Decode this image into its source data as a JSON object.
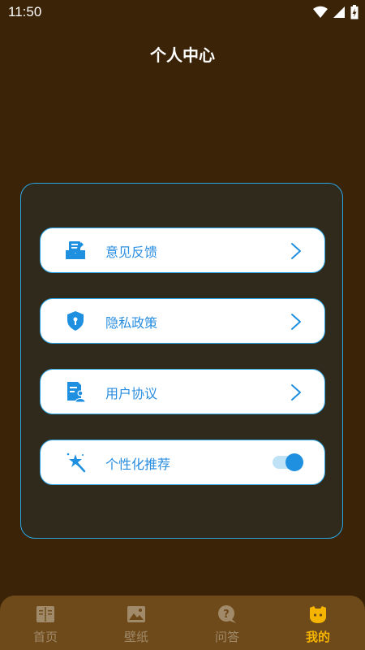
{
  "status_bar": {
    "time": "11:50"
  },
  "header": {
    "title": "个人中心"
  },
  "menu": [
    {
      "label": "意见反馈",
      "icon": "feedback-icon"
    },
    {
      "label": "隐私政策",
      "icon": "shield-icon"
    },
    {
      "label": "用户协议",
      "icon": "agreement-icon"
    },
    {
      "label": "个性化推荐",
      "icon": "magic-wand-icon",
      "toggle_on": true
    }
  ],
  "bottom_nav": [
    {
      "label": "首页",
      "icon": "book-icon",
      "active": false
    },
    {
      "label": "壁纸",
      "icon": "image-icon",
      "active": false
    },
    {
      "label": "问答",
      "icon": "question-bubble-icon",
      "active": false
    },
    {
      "label": "我的",
      "icon": "face-icon",
      "active": true
    }
  ],
  "colors": {
    "background": "#3a2307",
    "accent": "#2aa6e8",
    "nav_background": "#6e4a1a",
    "nav_active": "#f5b400"
  }
}
